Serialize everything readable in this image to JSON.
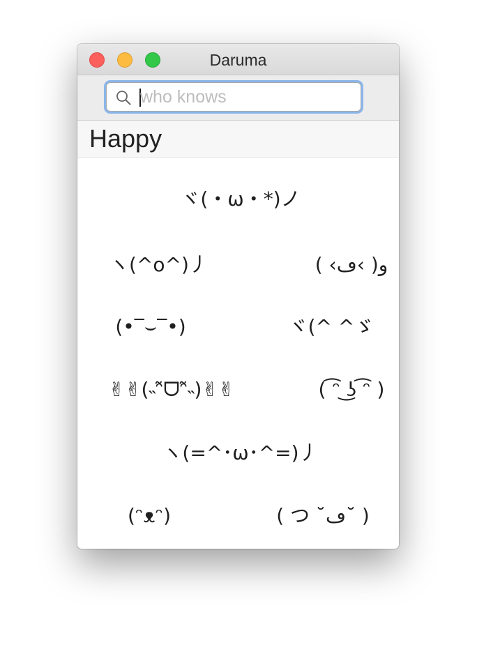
{
  "window": {
    "title": "Daruma"
  },
  "search": {
    "placeholder": "who knows",
    "value": ""
  },
  "section": {
    "title": "Happy"
  },
  "emoticons": [
    "ヾ(・ω・*)ノ",
    "ヽ(^o^)丿",
    "( ‹ڡ‹ )و",
    "(•‾⌣‾•)",
    "ヾ(^ ^ゞ",
    "✌✌(˵ᵔ̃ᗜᵔ̃˵)✌✌",
    "( ͡ᵔ ͜ʖ ͡ᵔ )",
    "ヽ(=^･ω･^=)丿",
    "(ᵔᴥᵔ)",
    "( つ ˘ڡ˘ )"
  ]
}
